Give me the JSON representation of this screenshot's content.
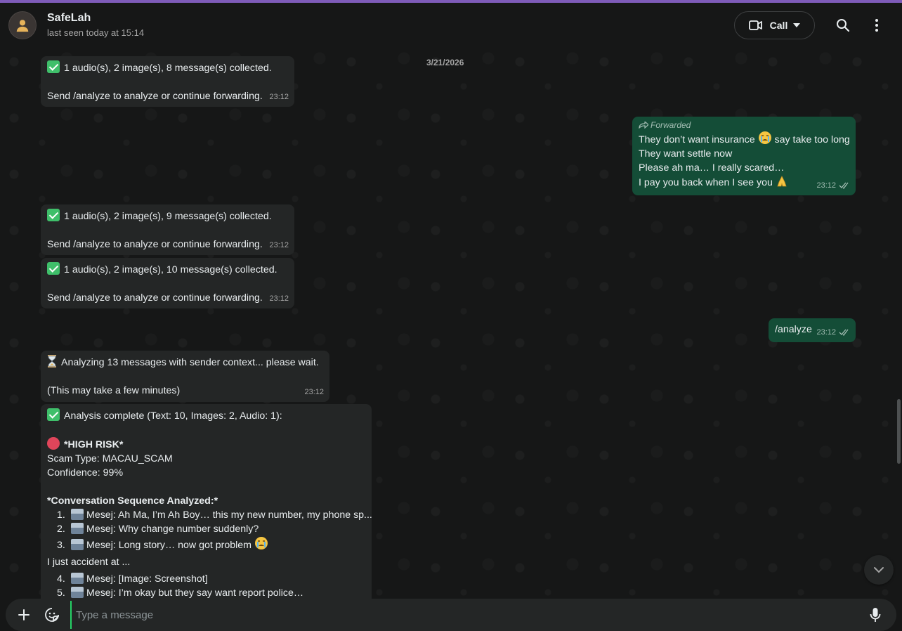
{
  "header": {
    "contact_name": "SafeLah",
    "status": "last seen today at 15:14",
    "call_label": "Call"
  },
  "date_chip": "3/21/2026",
  "messages": {
    "m1": {
      "line1": "1 audio(s), 2 image(s), 8 message(s) collected.",
      "line2": "Send /analyze to analyze or continue forwarding.",
      "time": "23:12"
    },
    "m2": {
      "forwarded_label": "Forwarded",
      "line1a": "They don’t want insurance ",
      "line1b": " say take too long",
      "line2": "They want settle now",
      "line3": "Please ah ma… I really scared…",
      "line4": "I pay you back when I see you ",
      "time": "23:12"
    },
    "m3": {
      "line1": "1 audio(s), 2 image(s), 9 message(s) collected.",
      "line2": "Send /analyze to analyze or continue forwarding.",
      "time": "23:12"
    },
    "m4": {
      "line1": "1 audio(s), 2 image(s), 10 message(s) collected.",
      "line2": "Send /analyze to analyze or continue forwarding.",
      "time": "23:12"
    },
    "m5": {
      "text": "/analyze",
      "time": "23:12"
    },
    "m6": {
      "line1": "Analyzing 13 messages with sender context... please wait.",
      "line2": "(This may take a few minutes)",
      "time": "23:12"
    },
    "m7": {
      "line1": "Analysis complete (Text: 10, Images: 2, Audio: 1):",
      "risk": "*HIGH RISK*",
      "scam_type": "Scam Type: MACAU_SCAM",
      "confidence": "Confidence: 99%",
      "seq_heading": "*Conversation Sequence Analyzed:*",
      "items": [
        {
          "num": "1.",
          "text": "Mesej: Ah Ma, I’m Ah Boy… this my new number, my phone sp..."
        },
        {
          "num": "2.",
          "text": "Mesej: Why change number suddenly?"
        },
        {
          "num": "3.",
          "text": "Mesej: Long story… now got problem "
        }
      ],
      "interlude": "I just accident at ...",
      "items2": [
        {
          "num": "4.",
          "text": "Mesej: [Image: Screenshot]"
        },
        {
          "num": "5.",
          "text": "Mesej: I’m okay but they say want report police…"
        }
      ]
    }
  },
  "composer": {
    "placeholder": "Type a message"
  },
  "colors": {
    "incoming_bubble": "#242626",
    "outgoing_bubble": "#144d37",
    "accent": "#25d366",
    "top_accent": "#7e5bb8"
  }
}
